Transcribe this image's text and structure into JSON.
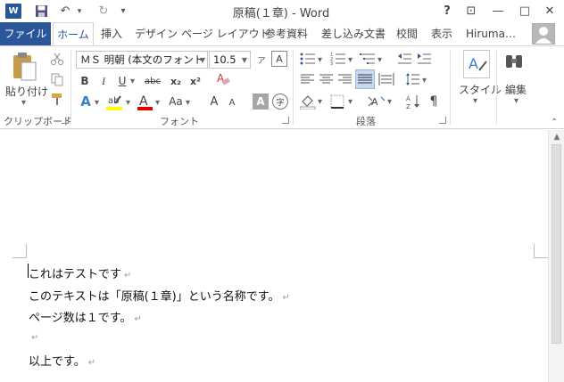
{
  "title_bar": {
    "app_icon": "W",
    "document_title": "原稿(１章) - Word",
    "qat": {
      "save_icon": "save-icon",
      "undo_icon": "↶",
      "redo_icon": "↻",
      "customize_icon": "▾"
    },
    "help": "?",
    "window_controls": {
      "ribbon_display": "⊡",
      "minimize": "—",
      "maximize": "□",
      "close": "✕"
    }
  },
  "ribbon_tabs": [
    "ファイル",
    "ホーム",
    "挿入",
    "デザイン",
    "ページ レイアウト",
    "参考資料",
    "差し込み文書",
    "校閲",
    "表示",
    "Hiruma…"
  ],
  "ribbon": {
    "clipboard": {
      "label": "クリップボード",
      "paste": "貼り付け"
    },
    "font": {
      "label": "フォント",
      "font_name": "ＭＳ 明朝 (本文のフォント",
      "font_size": "10.5",
      "bold": "B",
      "italic": "I",
      "underline": "U",
      "strike": "abc",
      "subscript": "x₂",
      "superscript": "x²",
      "grow": "A",
      "shrink": "A",
      "case": "Aa",
      "char_shading": "A",
      "enclose": "字"
    },
    "paragraph": {
      "label": "段落"
    },
    "styles": {
      "label": "スタイル"
    },
    "editing": {
      "label": "編集"
    }
  },
  "document": {
    "paragraphs": [
      "これはテストです",
      "このテキストは「原稿(１章)」という名称です。",
      "ページ数は１です。",
      "",
      "以上です。"
    ],
    "paragraph_mark": "↵"
  },
  "colors": {
    "accent": "#2b579a",
    "highlight": "#ffff00",
    "font_color": "#e00000"
  }
}
